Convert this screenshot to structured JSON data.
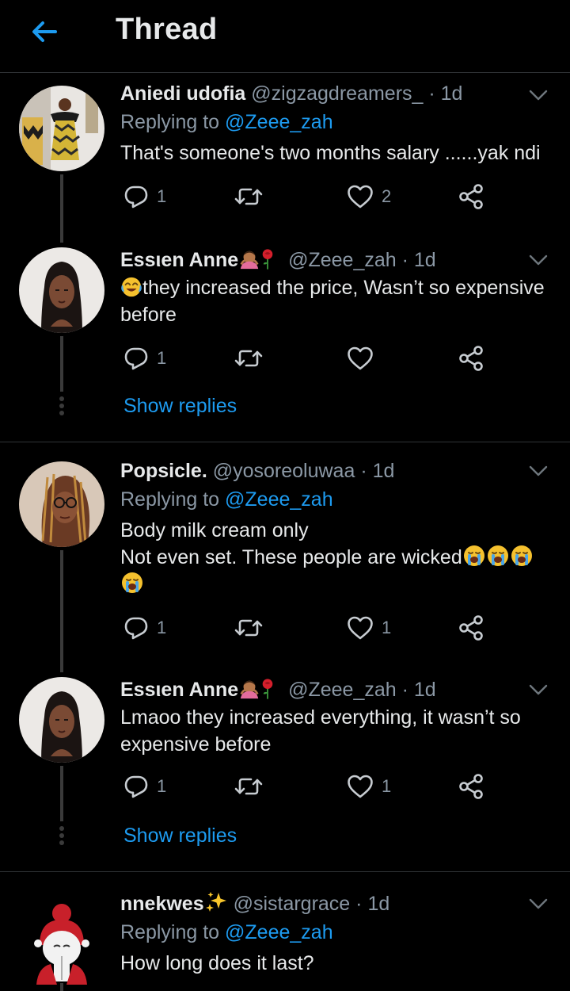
{
  "header": {
    "title": "Thread"
  },
  "tweets": [
    {
      "name": "Aniedi udofia",
      "handle": "@zigzagdreamers_",
      "time": "1d",
      "replying_prefix": "Replying to",
      "replying_to": "@Zeee_zah",
      "text": "That's someone's two months salary ......yak ndi",
      "reply_count": "1",
      "like_count": "2"
    },
    {
      "name": "Essιen Anne",
      "handle": "@Zeee_zah",
      "time": "1d",
      "text_line1": "they increased the price, Wasn’t so expensive",
      "text_line2": "before",
      "reply_count": "1",
      "show_replies": "Show replies"
    },
    {
      "name": "Popsicle.",
      "handle": "@yosoreoluwaa",
      "time": "1d",
      "replying_prefix": "Replying to",
      "replying_to": "@Zeee_zah",
      "text_line1": "Body milk cream only",
      "text_line2": "Not even set. These people are wicked",
      "reply_count": "1",
      "like_count": "1"
    },
    {
      "name": "Essιen Anne",
      "handle": "@Zeee_zah",
      "time": "1d",
      "text_line1": "Lmaoo they increased everything, it wasn’t so",
      "text_line2": "expensive before",
      "reply_count": "1",
      "like_count": "1",
      "show_replies": "Show replies"
    },
    {
      "name": "nnekwes",
      "handle": "@sistargrace",
      "time": "1d",
      "replying_prefix": "Replying to",
      "replying_to": "@Zeee_zah",
      "text": "How long does it last?"
    }
  ],
  "icons": {
    "back": "arrow-left-icon",
    "caret": "chevron-down-icon",
    "reply": "reply-icon",
    "retweet": "retweet-icon",
    "like": "heart-icon",
    "share": "share-icon"
  },
  "colors": {
    "accent": "#1d9bf0",
    "background": "#000000",
    "muted": "#8b98a5"
  }
}
